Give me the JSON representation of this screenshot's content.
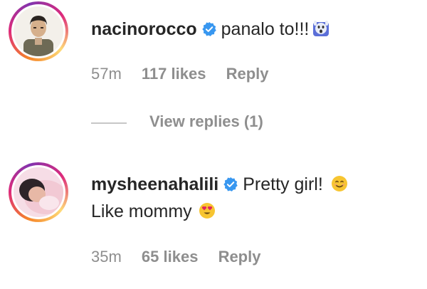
{
  "comments": [
    {
      "username": "nacinorocco",
      "text": "panalo to!!!",
      "emoji": "screaming-face-emoji",
      "time": "57m",
      "likes": "117 likes",
      "reply": "Reply",
      "view_replies": "View replies (1)"
    },
    {
      "username": "mysheenahalili",
      "text": "Pretty girl!",
      "emoji": "smiling-face-emoji",
      "text_line2": "Like mommy",
      "emoji2": "heart-eyes-emoji",
      "time": "35m",
      "likes": "65 likes",
      "reply": "Reply"
    }
  ],
  "colors": {
    "verified_blue": "#3897f0",
    "meta_gray": "#8e8e8e",
    "text_dark": "#262626"
  }
}
